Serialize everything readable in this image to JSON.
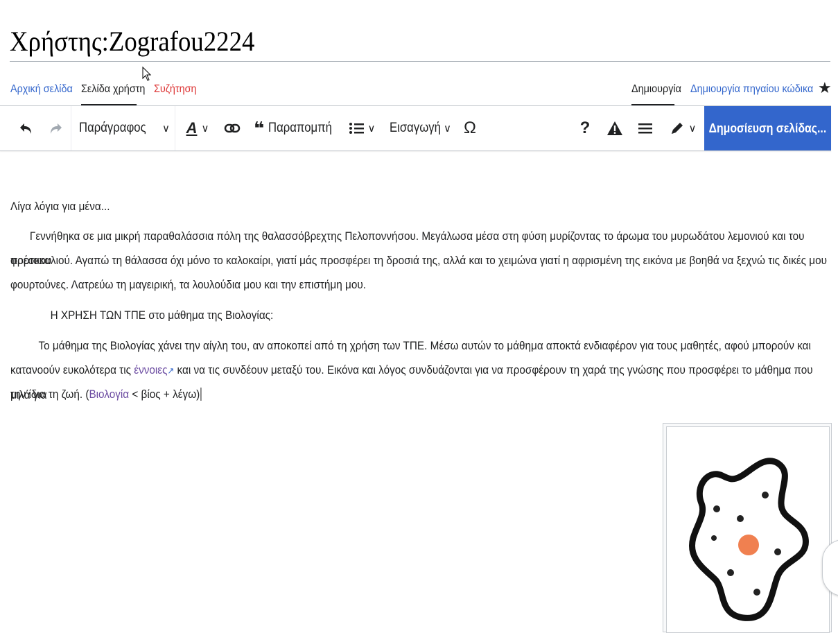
{
  "page": {
    "title": "Χρήστης:Zografou2224"
  },
  "tabs": {
    "left": [
      {
        "label": "Αρχική σελίδα"
      },
      {
        "label": "Σελίδα χρήστη"
      },
      {
        "label": "Συζήτηση"
      }
    ],
    "right": [
      {
        "label": "Δημιουργία"
      },
      {
        "label": "Δημιουργία πηγαίου κώδικα"
      }
    ],
    "watch_icon": "star-icon"
  },
  "toolbar": {
    "paragraph_label": "Παράγραφος",
    "cite_label": "Παραπομπή",
    "insert_label": "Εισαγωγή",
    "special_char": "Ω",
    "help": "?",
    "publish_label": "Δημοσίευση σελίδας...",
    "accent_color": "#3366cc"
  },
  "content": {
    "p1": "Λίγα λόγια για μένα...",
    "p2_line1": "Γεννήθηκα σε μια μικρή παραθαλάσσια πόλη της θαλασσόβρεχτης Πελοποννήσου. Μεγάλωσα μέσα στη φύση μυρίζοντας το άρωμα του μυρωδάτου λεμονιού και του φρέσκου",
    "p2_line2": "πορτοκαλιού. Αγαπώ τη θάλασσα όχι μόνο το καλοκαίρι, γιατί μάς προσφέρει τη δροσιά της, αλλά και το χειμώνα γιατί η αφρισμένη της εικόνα με βοηθά να ξεχνώ τις δικές μου",
    "p2_line3": "φουρτούνες. Λατρεύω τη μαγειρική, τα λουλούδια μου και την επιστήμη μου.",
    "p3": "Η ΧΡΗΣΗ ΤΩΝ ΤΠΕ στο μάθημα της Βιολογίας:",
    "p4_line1": "Το μάθημα της Βιολογίας χάνει την αίγλη του, αν αποκοπεί από τη χρήση των ΤΠΕ. Μέσω αυτών το μάθημα αποκτά ενδιαφέρον για τους μαθητές, αφού μπορούν και",
    "p4_line2_pre": "κατανοούν ευκολότερα τις ",
    "p4_link1": "έννοιες",
    "p4_line2_post": " και να τις συνδέουν μεταξύ του. Εικόνα και λόγος συνδυάζονται για να προσφέρουν τη χαρά της γνώσης που προσφέρει το μάθημα που μιλά για",
    "p4_line3_pre": "την ίδια τη ζωή. (",
    "p4_link2": "Βιολογία",
    "p4_line3_post": " < βίος + λέγω)"
  }
}
